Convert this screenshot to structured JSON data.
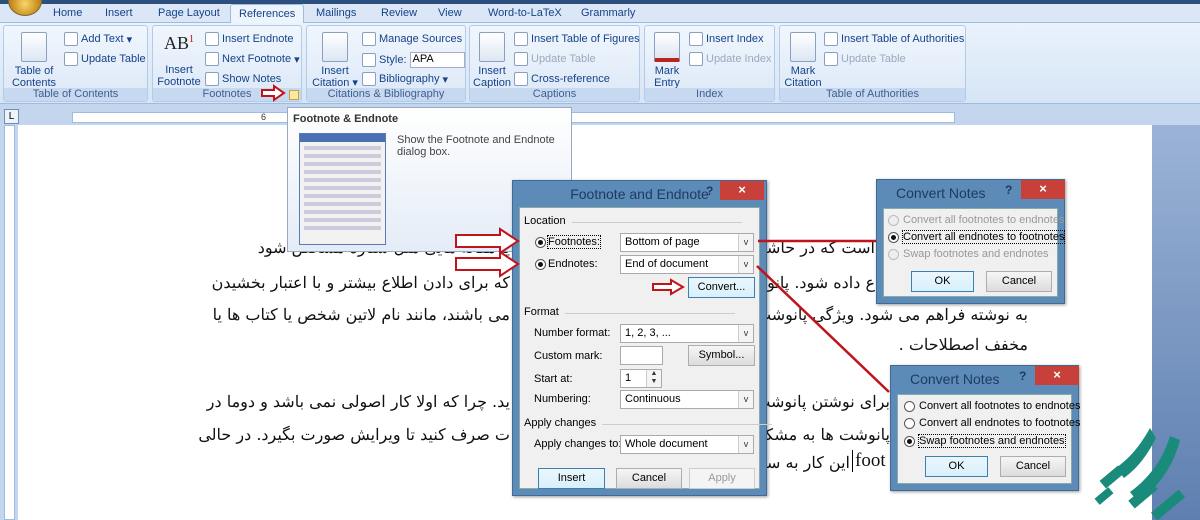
{
  "ribbon": {
    "tabs": [
      "Home",
      "Insert",
      "Page Layout",
      "References",
      "Mailings",
      "Review",
      "View",
      "Word-to-LaTeX",
      "Grammarly"
    ],
    "active_tab": "References",
    "groups": {
      "toc": {
        "label": "Table of Contents",
        "big": "Table of\nContents",
        "add_text": "Add Text",
        "update_table": "Update Table"
      },
      "footnotes": {
        "label": "Footnotes",
        "big": "Insert\nFootnote",
        "insert_endnote": "Insert Endnote",
        "next_footnote": "Next Footnote",
        "show_notes": "Show Notes"
      },
      "citations": {
        "label": "Citations & Bibliography",
        "big": "Insert\nCitation",
        "manage_sources": "Manage Sources",
        "style_label": "Style:",
        "style_value": "APA",
        "bibliography": "Bibliography"
      },
      "captions": {
        "label": "Captions",
        "big": "Insert\nCaption",
        "insert_tof": "Insert Table of Figures",
        "update_table": "Update Table",
        "cross_reference": "Cross-reference"
      },
      "index": {
        "label": "Index",
        "big": "Mark\nEntry",
        "insert_index": "Insert Index",
        "update_index": "Update Index"
      },
      "toa": {
        "label": "Table of Authorities",
        "big": "Mark\nCitation",
        "insert_toa": "Insert Table of Authorities",
        "update_table": "Update Table"
      }
    }
  },
  "ruler": {
    "tab_selector": "L",
    "number": "6"
  },
  "tooltip": {
    "title": "Footnote & Endnote",
    "description": "Show the Footnote and Endnote dialog box."
  },
  "footnote_dialog": {
    "title": "Footnote and Endnote",
    "help": "?",
    "close": "×",
    "location_label": "Location",
    "footnotes_label": "Footnotes:",
    "footnotes_value": "Bottom of page",
    "endnotes_label": "Endnotes:",
    "endnotes_value": "End of document",
    "selected_location": "Endnotes",
    "convert": "Convert...",
    "format_label": "Format",
    "number_format_label": "Number format:",
    "number_format_value": "1, 2, 3, ...",
    "custom_mark_label": "Custom mark:",
    "custom_mark_value": "",
    "symbol": "Symbol...",
    "start_at_label": "Start at:",
    "start_at_value": "1",
    "numbering_label": "Numbering:",
    "numbering_value": "Continuous",
    "apply_changes_label": "Apply changes",
    "apply_to_label": "Apply changes to:",
    "apply_to_value": "Whole document",
    "insert": "Insert",
    "cancel": "Cancel",
    "apply": "Apply"
  },
  "convert_notes": [
    {
      "title": "Convert Notes",
      "help": "?",
      "close": "×",
      "options": [
        {
          "label": "Convert all footnotes to endnotes",
          "selected": false,
          "enabled": false
        },
        {
          "label": "Convert all endnotes to footnotes",
          "selected": true,
          "enabled": true
        },
        {
          "label": "Swap footnotes and endnotes",
          "selected": false,
          "enabled": false
        }
      ],
      "ok": "OK",
      "cancel": "Cancel"
    },
    {
      "title": "Convert Notes",
      "help": "?",
      "close": "×",
      "options": [
        {
          "label": "Convert all footnotes to endnotes",
          "selected": false,
          "enabled": true
        },
        {
          "label": "Convert all endnotes to footnotes",
          "selected": false,
          "enabled": true
        },
        {
          "label": "Swap footnotes and endnotes",
          "selected": true,
          "enabled": true
        }
      ],
      "ok": "OK",
      "cancel": "Cancel"
    }
  ],
  "document": {
    "left_lines": [
      "یا مقاله هایی مثل ستاره مشخص شود",
      "که برای دادن اطلاع بیشتر و با اعتبار بخشیدن",
      "می باشند، مانند نام لاتین شخص یا کتاب ها یا",
      "ید. چرا که اولا کار اصولی نمی باشد و دوما در",
      "ت صرف کنید تا ویرایش صورت بگیرد. در حالی"
    ],
    "right_lines": [
      "است که در حاشیه",
      "ع داده شود. پانوشت",
      "به نوشته فراهم می شود. ویژگی پانوشت",
      "مخفف اصطلاحات .",
      "برای نوشتن پانوشت",
      "پانوشت ها به مشکل",
      "این کار به سا"
    ],
    "latin_fragment": "foot"
  },
  "colors": {
    "accent": "#15428b",
    "annotation_red": "#c0141c",
    "logo": "#1a8a7a",
    "dialog_frame": "#5c8bb8",
    "close_red": "#c7403a"
  }
}
